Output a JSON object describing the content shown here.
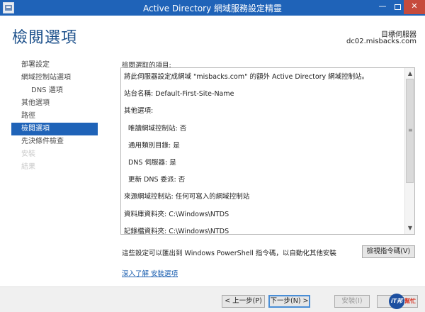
{
  "window": {
    "title": "Active Directory 網域服務設定精靈",
    "min_label": "—",
    "close_label": "✕"
  },
  "header": {
    "heading": "檢閱選項",
    "target_label": "目標伺服器",
    "target_name": "dc02.misbacks.com"
  },
  "nav": {
    "items": [
      {
        "label": "部署設定"
      },
      {
        "label": "網域控制站選項"
      },
      {
        "label": "DNS 選項"
      },
      {
        "label": "其他選項"
      },
      {
        "label": "路徑"
      },
      {
        "label": "檢閱選項"
      },
      {
        "label": "先決條件檢查"
      },
      {
        "label": "安裝"
      },
      {
        "label": "結果"
      }
    ]
  },
  "main": {
    "caption": "檢閱選取的項目:",
    "lines": [
      "將此伺服器設定成網域 \"misbacks.com\" 的額外 Active Directory 網域控制站。",
      "站台名稱: Default-First-Site-Name",
      "其他選項:",
      "唯讀網域控制站: 否",
      "通用類別目錄: 是",
      "DNS 伺服器: 是",
      "更新 DNS 委派: 否",
      "來源網域控制站: 任何可寫入的網域控制站",
      "資料庫資料夾: C:\\Windows\\NTDS",
      "記錄檔資料夾: C:\\Windows\\NTDS"
    ],
    "scroll_up": "▲",
    "scroll_down": "▼",
    "grip": "≡",
    "export_text": "這些設定可以匯出到 Windows PowerShell 指令碼，以自動化其他安裝",
    "view_script_label": "檢視指令碼(V)",
    "learn_more": "深入了解 安裝選項"
  },
  "footer": {
    "prev": "< 上一步(P)",
    "next": "下一步(N) >",
    "install": "安裝(I)",
    "cancel": "取消"
  },
  "watermark": {
    "circle": "iT邦",
    "text": "幫忙"
  },
  "colors": {
    "accent": "#1f63b8",
    "heading": "#1b4f8a",
    "close": "#c64b3c"
  }
}
